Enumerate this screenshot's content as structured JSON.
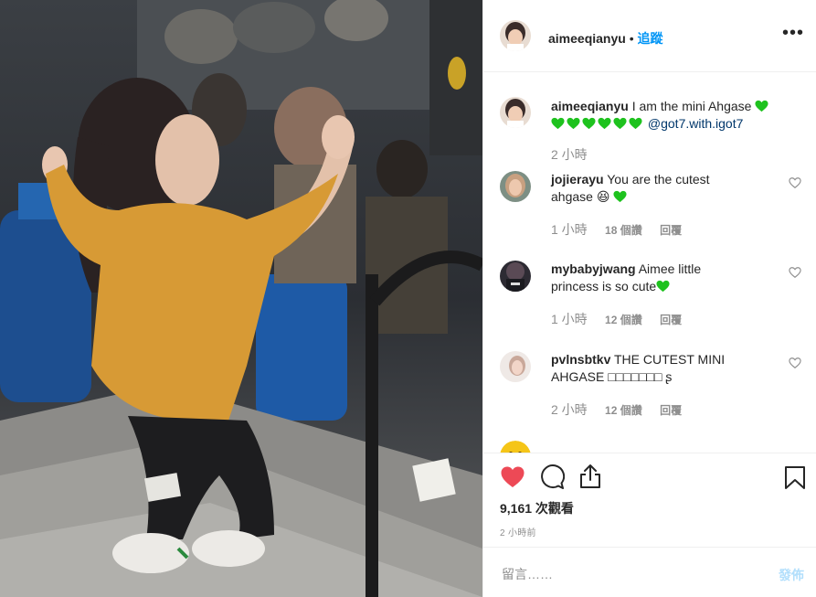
{
  "post": {
    "username": "aimeeqianyu",
    "separator": "•",
    "follow_label": "追蹤",
    "more_icon": "more-options-icon",
    "caption": {
      "username": "aimeeqianyu",
      "text": "I am the mini Ahgase",
      "mention": "@got7.with.igot7",
      "time": "2 小時"
    }
  },
  "comments": [
    {
      "username": "jojierayu",
      "text_1": "You are the cutest",
      "text_2": "ahgase",
      "emoji": "😆",
      "time": "1 小時",
      "likes": "18 個讚",
      "reply": "回覆"
    },
    {
      "username": "mybabyjwang",
      "text_1": "Aimee little",
      "text_2": "princess is so cute",
      "time": "1 小時",
      "likes": "12 個讚",
      "reply": "回覆"
    },
    {
      "username": "pvlnsbtkv",
      "text_1": "THE CUTEST MINI",
      "text_2": "AHGASE □□□□□□□ ʂ",
      "time": "2 小時",
      "likes": "12 個讚",
      "reply": "回覆"
    }
  ],
  "actions": {
    "views": "9,161 次觀看",
    "posted": "2 小時前"
  },
  "compose": {
    "placeholder": "留言……",
    "post_label": "發佈"
  },
  "colors": {
    "like_red": "#ed4956",
    "link_blue": "#0095f6",
    "heart_green": "#1ec21e"
  }
}
